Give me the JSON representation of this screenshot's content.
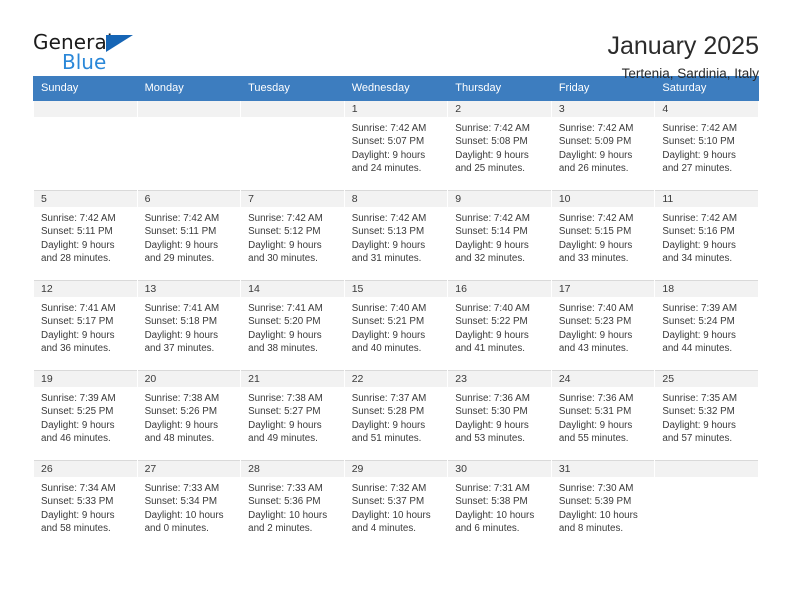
{
  "brand": {
    "name_part1": "General",
    "name_part2": "Blue",
    "triangle_color": "#1665b5",
    "blue_color": "#2a87d8"
  },
  "header": {
    "title": "January 2025",
    "subtitle": "Tertenia, Sardinia, Italy"
  },
  "theme": {
    "header_row_bg": "#3d7dbf",
    "daynum_bg": "#f2f2f2",
    "text_color": "#3a3a3a"
  },
  "calendar": {
    "weekday_headers": [
      "Sunday",
      "Monday",
      "Tuesday",
      "Wednesday",
      "Thursday",
      "Friday",
      "Saturday"
    ],
    "weeks": [
      [
        {
          "day": "",
          "lines": []
        },
        {
          "day": "",
          "lines": []
        },
        {
          "day": "",
          "lines": []
        },
        {
          "day": "1",
          "lines": [
            "Sunrise: 7:42 AM",
            "Sunset: 5:07 PM",
            "Daylight: 9 hours",
            "and 24 minutes."
          ]
        },
        {
          "day": "2",
          "lines": [
            "Sunrise: 7:42 AM",
            "Sunset: 5:08 PM",
            "Daylight: 9 hours",
            "and 25 minutes."
          ]
        },
        {
          "day": "3",
          "lines": [
            "Sunrise: 7:42 AM",
            "Sunset: 5:09 PM",
            "Daylight: 9 hours",
            "and 26 minutes."
          ]
        },
        {
          "day": "4",
          "lines": [
            "Sunrise: 7:42 AM",
            "Sunset: 5:10 PM",
            "Daylight: 9 hours",
            "and 27 minutes."
          ]
        }
      ],
      [
        {
          "day": "5",
          "lines": [
            "Sunrise: 7:42 AM",
            "Sunset: 5:11 PM",
            "Daylight: 9 hours",
            "and 28 minutes."
          ]
        },
        {
          "day": "6",
          "lines": [
            "Sunrise: 7:42 AM",
            "Sunset: 5:11 PM",
            "Daylight: 9 hours",
            "and 29 minutes."
          ]
        },
        {
          "day": "7",
          "lines": [
            "Sunrise: 7:42 AM",
            "Sunset: 5:12 PM",
            "Daylight: 9 hours",
            "and 30 minutes."
          ]
        },
        {
          "day": "8",
          "lines": [
            "Sunrise: 7:42 AM",
            "Sunset: 5:13 PM",
            "Daylight: 9 hours",
            "and 31 minutes."
          ]
        },
        {
          "day": "9",
          "lines": [
            "Sunrise: 7:42 AM",
            "Sunset: 5:14 PM",
            "Daylight: 9 hours",
            "and 32 minutes."
          ]
        },
        {
          "day": "10",
          "lines": [
            "Sunrise: 7:42 AM",
            "Sunset: 5:15 PM",
            "Daylight: 9 hours",
            "and 33 minutes."
          ]
        },
        {
          "day": "11",
          "lines": [
            "Sunrise: 7:42 AM",
            "Sunset: 5:16 PM",
            "Daylight: 9 hours",
            "and 34 minutes."
          ]
        }
      ],
      [
        {
          "day": "12",
          "lines": [
            "Sunrise: 7:41 AM",
            "Sunset: 5:17 PM",
            "Daylight: 9 hours",
            "and 36 minutes."
          ]
        },
        {
          "day": "13",
          "lines": [
            "Sunrise: 7:41 AM",
            "Sunset: 5:18 PM",
            "Daylight: 9 hours",
            "and 37 minutes."
          ]
        },
        {
          "day": "14",
          "lines": [
            "Sunrise: 7:41 AM",
            "Sunset: 5:20 PM",
            "Daylight: 9 hours",
            "and 38 minutes."
          ]
        },
        {
          "day": "15",
          "lines": [
            "Sunrise: 7:40 AM",
            "Sunset: 5:21 PM",
            "Daylight: 9 hours",
            "and 40 minutes."
          ]
        },
        {
          "day": "16",
          "lines": [
            "Sunrise: 7:40 AM",
            "Sunset: 5:22 PM",
            "Daylight: 9 hours",
            "and 41 minutes."
          ]
        },
        {
          "day": "17",
          "lines": [
            "Sunrise: 7:40 AM",
            "Sunset: 5:23 PM",
            "Daylight: 9 hours",
            "and 43 minutes."
          ]
        },
        {
          "day": "18",
          "lines": [
            "Sunrise: 7:39 AM",
            "Sunset: 5:24 PM",
            "Daylight: 9 hours",
            "and 44 minutes."
          ]
        }
      ],
      [
        {
          "day": "19",
          "lines": [
            "Sunrise: 7:39 AM",
            "Sunset: 5:25 PM",
            "Daylight: 9 hours",
            "and 46 minutes."
          ]
        },
        {
          "day": "20",
          "lines": [
            "Sunrise: 7:38 AM",
            "Sunset: 5:26 PM",
            "Daylight: 9 hours",
            "and 48 minutes."
          ]
        },
        {
          "day": "21",
          "lines": [
            "Sunrise: 7:38 AM",
            "Sunset: 5:27 PM",
            "Daylight: 9 hours",
            "and 49 minutes."
          ]
        },
        {
          "day": "22",
          "lines": [
            "Sunrise: 7:37 AM",
            "Sunset: 5:28 PM",
            "Daylight: 9 hours",
            "and 51 minutes."
          ]
        },
        {
          "day": "23",
          "lines": [
            "Sunrise: 7:36 AM",
            "Sunset: 5:30 PM",
            "Daylight: 9 hours",
            "and 53 minutes."
          ]
        },
        {
          "day": "24",
          "lines": [
            "Sunrise: 7:36 AM",
            "Sunset: 5:31 PM",
            "Daylight: 9 hours",
            "and 55 minutes."
          ]
        },
        {
          "day": "25",
          "lines": [
            "Sunrise: 7:35 AM",
            "Sunset: 5:32 PM",
            "Daylight: 9 hours",
            "and 57 minutes."
          ]
        }
      ],
      [
        {
          "day": "26",
          "lines": [
            "Sunrise: 7:34 AM",
            "Sunset: 5:33 PM",
            "Daylight: 9 hours",
            "and 58 minutes."
          ]
        },
        {
          "day": "27",
          "lines": [
            "Sunrise: 7:33 AM",
            "Sunset: 5:34 PM",
            "Daylight: 10 hours",
            "and 0 minutes."
          ]
        },
        {
          "day": "28",
          "lines": [
            "Sunrise: 7:33 AM",
            "Sunset: 5:36 PM",
            "Daylight: 10 hours",
            "and 2 minutes."
          ]
        },
        {
          "day": "29",
          "lines": [
            "Sunrise: 7:32 AM",
            "Sunset: 5:37 PM",
            "Daylight: 10 hours",
            "and 4 minutes."
          ]
        },
        {
          "day": "30",
          "lines": [
            "Sunrise: 7:31 AM",
            "Sunset: 5:38 PM",
            "Daylight: 10 hours",
            "and 6 minutes."
          ]
        },
        {
          "day": "31",
          "lines": [
            "Sunrise: 7:30 AM",
            "Sunset: 5:39 PM",
            "Daylight: 10 hours",
            "and 8 minutes."
          ]
        },
        {
          "day": "",
          "lines": []
        }
      ]
    ]
  }
}
